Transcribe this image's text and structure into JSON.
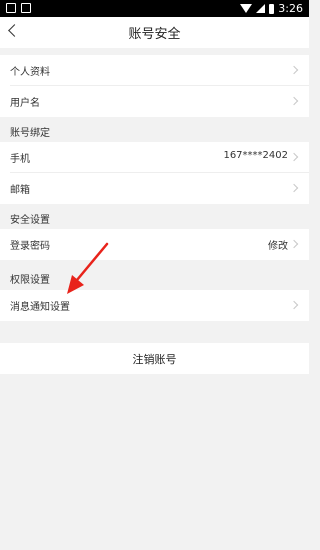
{
  "status_bar": {
    "time": "3:26"
  },
  "header": {
    "title": "账号安全"
  },
  "rows": {
    "profile": {
      "label": "个人资料"
    },
    "username": {
      "label": "用户名"
    },
    "phone": {
      "label": "手机",
      "value": "167****2402"
    },
    "email": {
      "label": "邮箱"
    },
    "password": {
      "label": "登录密码",
      "value": "修改"
    },
    "notification": {
      "label": "消息通知设置"
    }
  },
  "sections": {
    "binding": "账号绑定",
    "security": "安全设置",
    "permissions": "权限设置"
  },
  "cancel_account": {
    "label": "注销账号"
  },
  "colors": {
    "annotation_arrow": "#e8231b",
    "background": "#f2f2f2"
  }
}
